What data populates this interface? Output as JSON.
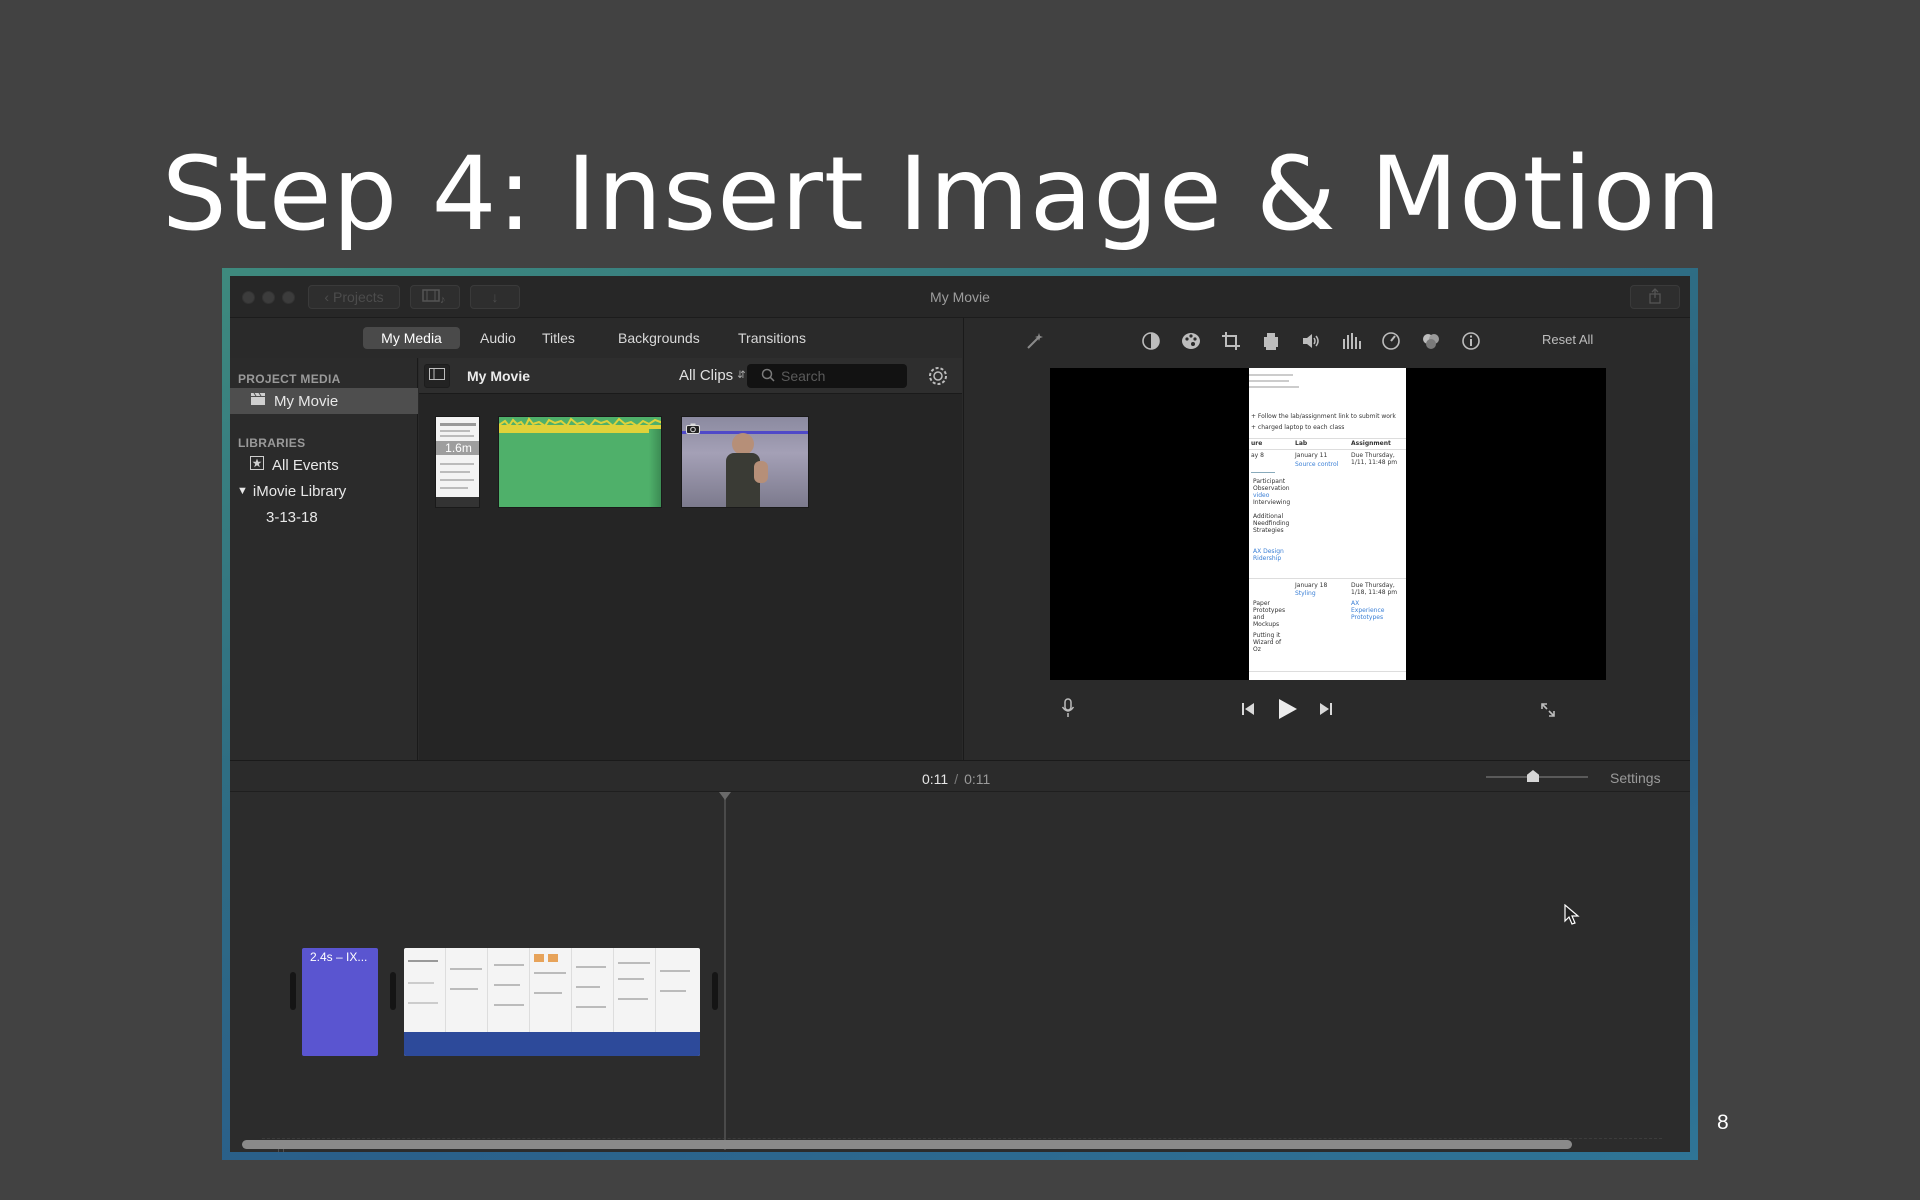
{
  "slide": {
    "title": "Step 4: Insert Image & Motion",
    "page_number": "8"
  },
  "window": {
    "title": "My Movie",
    "projects_button": "Projects"
  },
  "tabs": [
    {
      "label": "My Media",
      "active": true
    },
    {
      "label": "Audio",
      "active": false
    },
    {
      "label": "Titles",
      "active": false
    },
    {
      "label": "Backgrounds",
      "active": false
    },
    {
      "label": "Transitions",
      "active": false
    }
  ],
  "sidebar": {
    "project_media_heading": "PROJECT MEDIA",
    "project_item": "My Movie",
    "libraries_heading": "LIBRARIES",
    "all_events": "All Events",
    "library": "iMovie Library",
    "event": "3-13-18"
  },
  "browser": {
    "title": "My Movie",
    "filter": "All Clips",
    "search_placeholder": "Search",
    "thumb_duration": "1.6m"
  },
  "viewer": {
    "reset_all": "Reset All",
    "doc_lines": {
      "header": "+ Follow the lab/assignment link to submit work",
      "sub": "+ charged laptop to each class",
      "col1": "ure",
      "col2": "Lab",
      "col3": "Assignment",
      "r1c1": "ay 8",
      "r1c2": "January 11",
      "r1c3": "Due Thursday, 1/11, 11:48 pm",
      "r1link": "Source control",
      "r2": "Participant Observation",
      "r3": "video",
      "r4": "Interviewing",
      "r5": "Additional Needfinding Strategies",
      "r6": "AX Design Ridership",
      "r7c2": "January 18",
      "r7c3": "Due Thursday, 1/18, 11:48 pm",
      "r8": "Styling",
      "r9": "AX Experience Prototypes",
      "r10": "Paper Prototypes and Mockups",
      "r11": "Putting it Wizard of Oz"
    }
  },
  "timeline": {
    "current_time": "0:11",
    "separator": "/",
    "total_time": "0:11",
    "settings": "Settings",
    "zoom_level": 0.45,
    "title_clip_label": "2.4s – IX..."
  },
  "colors": {
    "title_clip": "#5a55d0",
    "audio_waveform": "#e0d23a",
    "audio_clip": "#4fb06a",
    "clip_audio_band": "#2d4a9a"
  }
}
